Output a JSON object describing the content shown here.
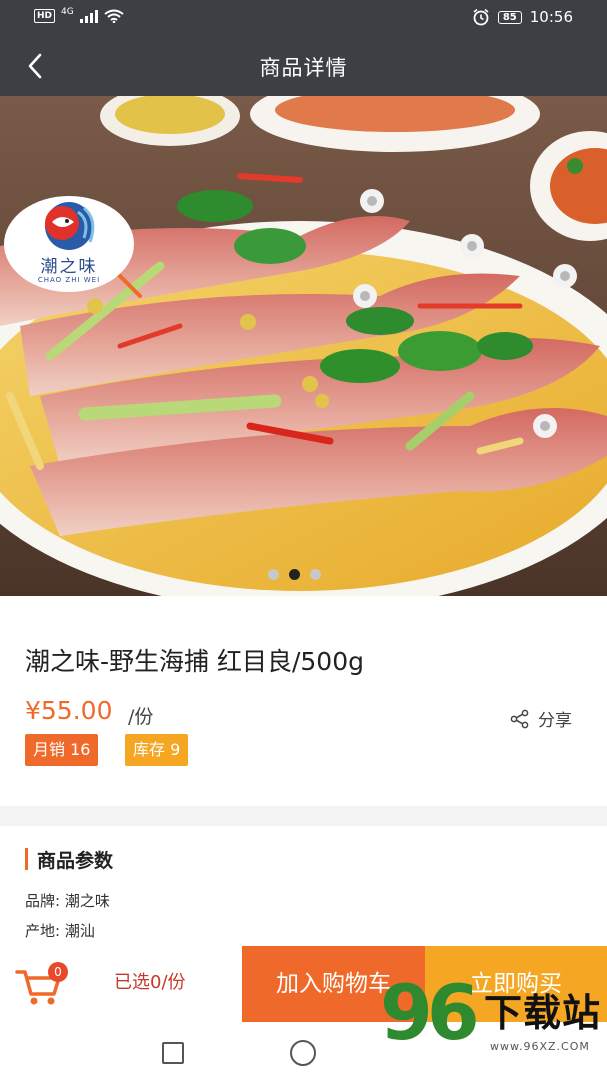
{
  "status_bar": {
    "hd_label": "HD",
    "network": "4G",
    "battery": "85",
    "time": "10:56"
  },
  "header": {
    "title": "商品详情"
  },
  "hero": {
    "logo_name": "潮之味",
    "logo_sub": "CHAO ZHI WEI",
    "carousel_total": 3,
    "carousel_active": 2
  },
  "product": {
    "title": "潮之味-野生海捕 红目良/500g",
    "price": "¥55.00",
    "unit": "/份",
    "share_label": "分享",
    "sales_badge": "月销 16",
    "stock_badge": "库存 9"
  },
  "params": {
    "heading": "商品参数",
    "rows": [
      {
        "key": "品牌:",
        "value": "潮之味"
      },
      {
        "key": "产地:",
        "value": "潮汕"
      }
    ]
  },
  "action_bar": {
    "cart_count": "0",
    "selected_text": "已选0/份",
    "add_to_cart": "加入购物车",
    "buy_now": "立即购买"
  },
  "watermark": {
    "number": "96",
    "word": "下载站",
    "url": "www.96XZ.COM"
  },
  "colors": {
    "header_bg": "#3c3f44",
    "price": "#ef6a2a",
    "add_cart_bg": "#ef6a2a",
    "buy_now_bg": "#f5a623",
    "watermark_green": "#2f8a2f"
  },
  "icons": {
    "back": "back-arrow-icon",
    "share": "share-icon",
    "cart": "shopping-cart-icon",
    "wifi": "wifi-icon",
    "signal": "signal-icon",
    "alarm": "alarm-icon"
  }
}
